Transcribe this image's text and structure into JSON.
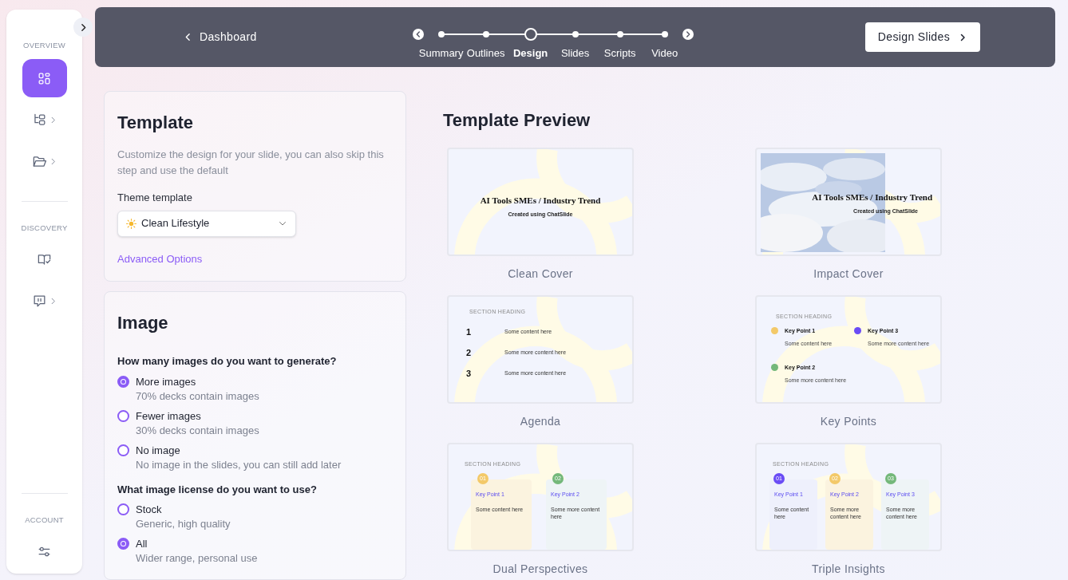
{
  "sidebar": {
    "sections": [
      {
        "heading": "OVERVIEW",
        "items": [
          {
            "kind": "grid",
            "selected": true,
            "submenu": false
          },
          {
            "kind": "tree",
            "selected": false,
            "submenu": true
          },
          {
            "kind": "folder",
            "selected": false,
            "submenu": true
          }
        ]
      },
      {
        "heading": "DISCOVERY",
        "items": [
          {
            "kind": "book",
            "selected": false,
            "submenu": false
          },
          {
            "kind": "chat",
            "selected": false,
            "submenu": true
          }
        ]
      },
      {
        "heading": "ACCOUNT",
        "items": [
          {
            "kind": "sliders",
            "selected": false,
            "submenu": false
          }
        ]
      }
    ]
  },
  "top_bar": {
    "back_link": "Dashboard",
    "steps": [
      {
        "label": "Summary",
        "current": false
      },
      {
        "label": "Outlines",
        "current": false
      },
      {
        "label": "Design",
        "current": true
      },
      {
        "label": "Slides",
        "current": false
      },
      {
        "label": "Scripts",
        "current": false
      },
      {
        "label": "Video",
        "current": false
      }
    ],
    "next_button": "Design Slides"
  },
  "template_card": {
    "title": "Template",
    "description": "Customize the design for your slide, you can also skip this step and use the default",
    "field_label": "Theme template",
    "select_value": "Clean Lifestyle",
    "link": "Advanced Options"
  },
  "image_card": {
    "title": "Image",
    "questions": [
      {
        "question": "How many images do you want to generate?",
        "options": [
          {
            "label": "More images",
            "description": "70% decks contain images",
            "selected": true
          },
          {
            "label": "Fewer images",
            "description": "30% decks contain images",
            "selected": false
          },
          {
            "label": "No image",
            "description": "No image in the slides, you can still add later",
            "selected": false
          }
        ]
      },
      {
        "question": "What image license do you want to use?",
        "options": [
          {
            "label": "Stock",
            "description": "Generic, high quality",
            "selected": false
          },
          {
            "label": "All",
            "description": "Wider range, personal use",
            "selected": true
          }
        ]
      }
    ]
  },
  "preview": {
    "title": "Template Preview",
    "templates": [
      {
        "kind": "cover",
        "name": "Clean Cover",
        "slide_title": "AI Tools SMEs / Industry Trend",
        "slide_subtitle": "Created using ChatSlide"
      },
      {
        "kind": "impact",
        "name": "Impact Cover",
        "slide_title": "AI Tools SMEs / Industry Trend",
        "slide_subtitle": "Created using ChatSlide"
      },
      {
        "kind": "agenda",
        "name": "Agenda",
        "heading": "SECTION HEADING",
        "items": [
          {
            "number": "1",
            "text": "Some content here"
          },
          {
            "number": "2",
            "text": "Some more content here"
          },
          {
            "number": "3",
            "text": "Some more content here"
          }
        ]
      },
      {
        "kind": "keypoints",
        "name": "Key Points",
        "heading": "SECTION HEADING",
        "items": [
          {
            "title": "Key Point 1",
            "text": "Some content here",
            "color": "#f3c969"
          },
          {
            "title": "Key Point 3",
            "text": "Some more content here",
            "color": "#6a4cf5"
          },
          {
            "title": "Key Point 2",
            "text": "Some more content here",
            "color": "#74b87a"
          }
        ]
      },
      {
        "kind": "columns",
        "name": "Dual Perspectives",
        "heading": "SECTION HEADING",
        "items": [
          {
            "number": "01",
            "title": "Key Point 1",
            "text": "Some content here",
            "color": "#f3c969"
          },
          {
            "number": "02",
            "title": "Key Point 2",
            "text": "Some more content here",
            "color": "#74b87a"
          }
        ]
      },
      {
        "kind": "columns",
        "name": "Triple Insights",
        "heading": "SECTION HEADING",
        "items": [
          {
            "number": "01",
            "title": "Key Point 1",
            "text": "Some content here",
            "color": "#6a4cf5"
          },
          {
            "number": "02",
            "title": "Key Point 2",
            "text": "Some more content here",
            "color": "#f3c969"
          },
          {
            "number": "03",
            "title": "Key Point 3",
            "text": "Some more content here",
            "color": "#74b87a"
          }
        ]
      }
    ]
  }
}
